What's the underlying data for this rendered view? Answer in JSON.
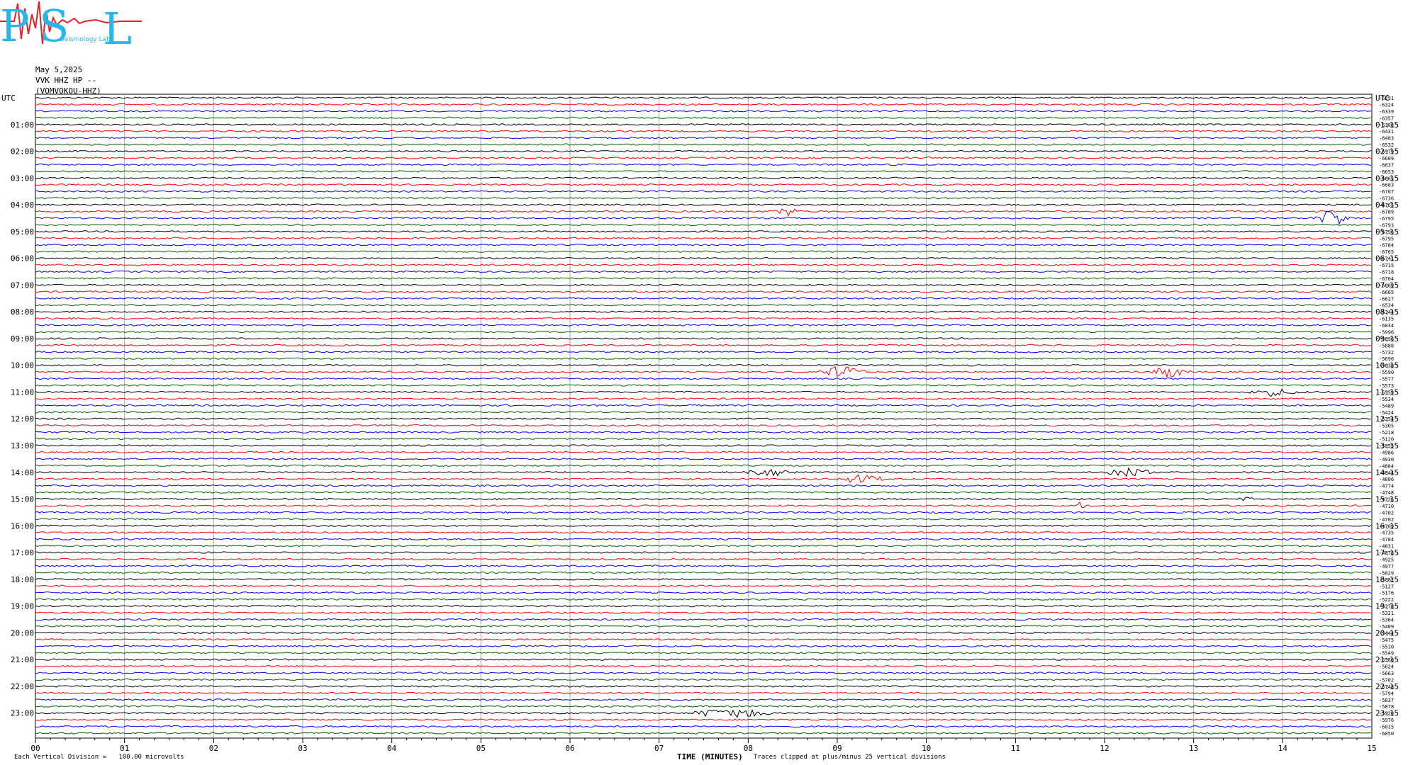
{
  "logo": {
    "letters": [
      "P",
      "S",
      "L"
    ],
    "subtext": "Seismology Lab",
    "colors": {
      "letters": "#29b6e8",
      "wave": "#e8202a"
    }
  },
  "header": {
    "date": "May 5,2025",
    "station": "VVK HHZ HP --",
    "location": "(VOMVOKOU-HHZ)"
  },
  "footer": {
    "vertical_division_label": "Each Vertical Division =",
    "vertical_division_value": "100.00 microvolts",
    "x_title": "TIME (MINUTES)",
    "clip_note": "Traces clipped at plus/minus 25 vertical divisions"
  },
  "chart_data": {
    "type": "helicorder",
    "timezone_label": "UTC",
    "x_ticks": [
      "00",
      "01",
      "02",
      "03",
      "04",
      "05",
      "06",
      "07",
      "08",
      "09",
      "10",
      "11",
      "12",
      "13",
      "14",
      "15"
    ],
    "xlim": [
      0,
      15
    ],
    "xlabel": "TIME (MINUTES)",
    "trace_color_cycle": [
      "#000000",
      "#ff0000",
      "#0000ff",
      "#006400"
    ],
    "left_hour_labels": [
      "UTC",
      "01:00",
      "02:00",
      "03:00",
      "04:00",
      "05:00",
      "06:00",
      "07:00",
      "08:00",
      "09:00",
      "10:00",
      "11:00",
      "12:00",
      "13:00",
      "14:00",
      "15:00",
      "16:00",
      "17:00",
      "18:00",
      "19:00",
      "20:00",
      "21:00",
      "22:00",
      "23:00"
    ],
    "right_hour_labels": [
      "UTC",
      "01:15",
      "02:15",
      "03:15",
      "04:15",
      "05:15",
      "06:15",
      "07:15",
      "08:15",
      "09:15",
      "10:15",
      "11:15",
      "12:15",
      "13:15",
      "14:15",
      "15:15",
      "16:15",
      "17:15",
      "18:15",
      "19:15",
      "20:15",
      "21:15",
      "22:15",
      "23:15"
    ],
    "trace_count": 96,
    "right_baseline_values": [
      "-6291",
      "-6324",
      "-6339",
      "-6357",
      "-6388",
      "-6431",
      "-6483",
      "-6532",
      "-6579",
      "-6609",
      "-6637",
      "-6653",
      "-6665",
      "-6683",
      "-6707",
      "-6736",
      "-6765",
      "-6789",
      "-6795",
      "-6793",
      "-6796",
      "-6795",
      "-6784",
      "-6765",
      "-6741",
      "-6715",
      "-6718",
      "-6704",
      "-6689",
      "-6665",
      "-6627",
      "-6534",
      "-6344",
      "-6135",
      "-6034",
      "-5996",
      "-5896",
      "-5888",
      "-5732",
      "-5690",
      "-5638",
      "-5590",
      "-5577",
      "-5573",
      "-5559",
      "-5534",
      "-5489",
      "-5424",
      "-5354",
      "-5305",
      "-5218",
      "-5120",
      "-5055",
      "-4986",
      "-4930",
      "-4884",
      "-4844",
      "-4806",
      "-4774",
      "-4748",
      "-4726",
      "-4710",
      "-4702",
      "-4702",
      "-4709",
      "-4735",
      "-4784",
      "-4831",
      "-4878",
      "-4925",
      "-4977",
      "-5029",
      "-5082",
      "-5127",
      "-5176",
      "-5222",
      "-5278",
      "-5321",
      "-5364",
      "-5409",
      "-5444",
      "-5475",
      "-5510",
      "-5549",
      "-5580",
      "-5624",
      "-5663",
      "-5702",
      "-5748",
      "-5794",
      "-5837",
      "-5878",
      "-5920",
      "-5976",
      "-6015",
      "-6050"
    ],
    "events": [
      {
        "trace": 17,
        "minute": 8.45,
        "amplitude": 0.7,
        "duration": 0.25
      },
      {
        "trace": 18,
        "minute": 14.55,
        "amplitude": 1.6,
        "duration": 0.25
      },
      {
        "trace": 41,
        "minute": 9.05,
        "amplitude": 1.2,
        "duration": 0.3
      },
      {
        "trace": 41,
        "minute": 12.72,
        "amplitude": 1.1,
        "duration": 0.3
      },
      {
        "trace": 44,
        "minute": 13.9,
        "amplitude": 0.6,
        "duration": 0.45
      },
      {
        "trace": 56,
        "minute": 8.25,
        "amplitude": 0.7,
        "duration": 0.35
      },
      {
        "trace": 56,
        "minute": 12.25,
        "amplitude": 1.0,
        "duration": 0.35
      },
      {
        "trace": 57,
        "minute": 9.25,
        "amplitude": 0.7,
        "duration": 0.35
      },
      {
        "trace": 61,
        "minute": 11.73,
        "amplitude": 1.0,
        "duration": 0.05
      },
      {
        "trace": 60,
        "minute": 13.55,
        "amplitude": 0.35,
        "duration": 0.15
      },
      {
        "trace": 92,
        "minute": 7.8,
        "amplitude": 0.9,
        "duration": 0.55
      },
      {
        "trace": 9,
        "minute": 10.03,
        "amplitude": 0.6,
        "duration": 0.03
      }
    ]
  }
}
